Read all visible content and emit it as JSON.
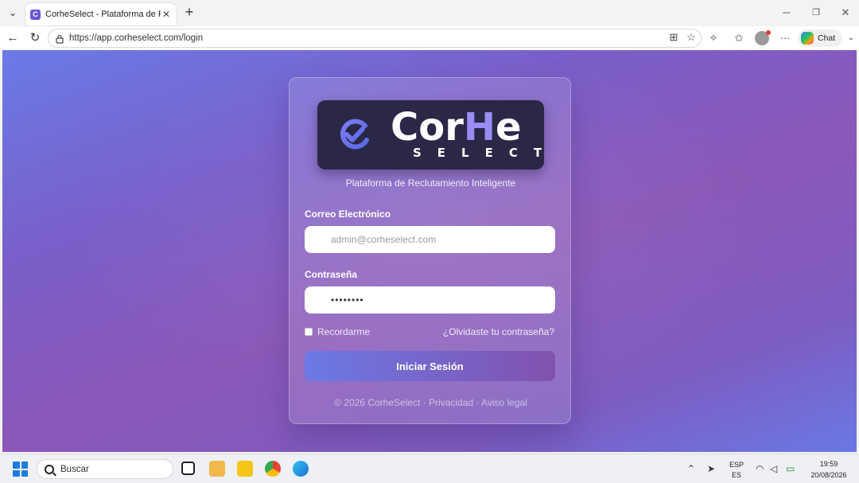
{
  "browser": {
    "tab_title": "CorheSelect - Plataforma de Reclutamiento",
    "url": "https://app.corheselect.com/login",
    "chat_label": "Chat"
  },
  "logo": {
    "word_main": "Cor",
    "word_accent": "H",
    "word_end": "e",
    "subtitle": "SELECT"
  },
  "login": {
    "tagline": "Plataforma de Reclutamiento Inteligente",
    "email_label": "Correo Electrónico",
    "email_placeholder": "admin@corheselect.com",
    "password_label": "Contraseña",
    "password_value": "••••••••",
    "remember_label": "Recordarme",
    "forgot_link": "¿Olvidaste tu contraseña?",
    "submit_label": "Iniciar Sesión",
    "footer": "© 2026 CorheSelect · Privacidad · Aviso legal"
  },
  "taskbar": {
    "search_label": "Buscar",
    "lang_top": "ESP",
    "lang_bottom": "ES",
    "time": "19:59",
    "date": "20/08/2026"
  },
  "colors": {
    "brand_purple": "#6d55d8",
    "logo_bg": "#2a2747",
    "accent": "#9a8cf4"
  }
}
